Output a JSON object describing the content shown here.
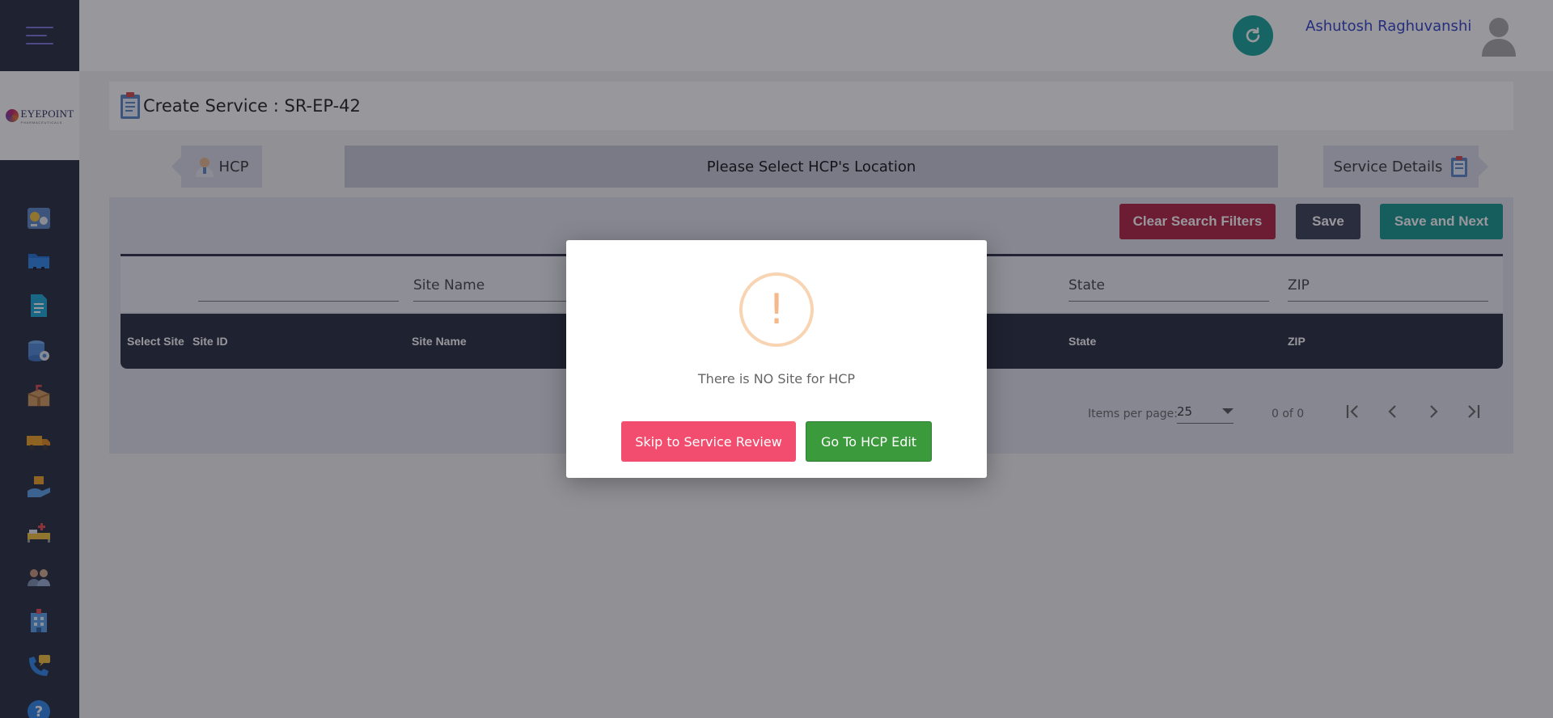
{
  "header": {
    "user_name": "Ashutosh Raghuvanshi"
  },
  "sidebar": {
    "logo": {
      "name": "EYEPOINT",
      "sub": "PHARMACEUTICALS"
    },
    "items": [
      {
        "icon": "dashboard-icon"
      },
      {
        "icon": "folder-icon"
      },
      {
        "icon": "document-icon"
      },
      {
        "icon": "database-icon"
      },
      {
        "icon": "package-icon"
      },
      {
        "icon": "truck-icon"
      },
      {
        "icon": "hand-box-icon"
      },
      {
        "icon": "hospital-bed-icon"
      },
      {
        "icon": "users-icon"
      },
      {
        "icon": "building-icon"
      },
      {
        "icon": "phone-chat-icon"
      },
      {
        "icon": "help-icon"
      }
    ]
  },
  "page": {
    "title": "Create Service : SR-EP-42"
  },
  "stepper": {
    "prev_label": "HCP",
    "current_label": "Please Select HCP's Location",
    "next_label": "Service Details"
  },
  "toolbar": {
    "clear_label": "Clear Search Filters",
    "save_label": "Save",
    "save_next_label": "Save and Next"
  },
  "filters": {
    "site_id_placeholder": "",
    "site_name_placeholder": "Site Name",
    "city_placeholder": "",
    "state_placeholder": "State",
    "zip_placeholder": "ZIP"
  },
  "table": {
    "columns": [
      "Select Site",
      "Site ID",
      "Site Name",
      "State",
      "ZIP"
    ]
  },
  "pagination": {
    "items_per_page_label": "Items per page:",
    "items_per_page_value": "25",
    "range_label": "0 of 0"
  },
  "modal": {
    "icon_text": "!",
    "message": "There is NO Site for HCP",
    "skip_label": "Skip to Service Review",
    "edit_label": "Go To HCP Edit"
  },
  "colors": {
    "sidebar_bg": "#262a3b",
    "accent_teal": "#14988f",
    "danger": "#b22140",
    "modal_skip": "#f24d6e",
    "modal_edit": "#3a9a3c"
  }
}
